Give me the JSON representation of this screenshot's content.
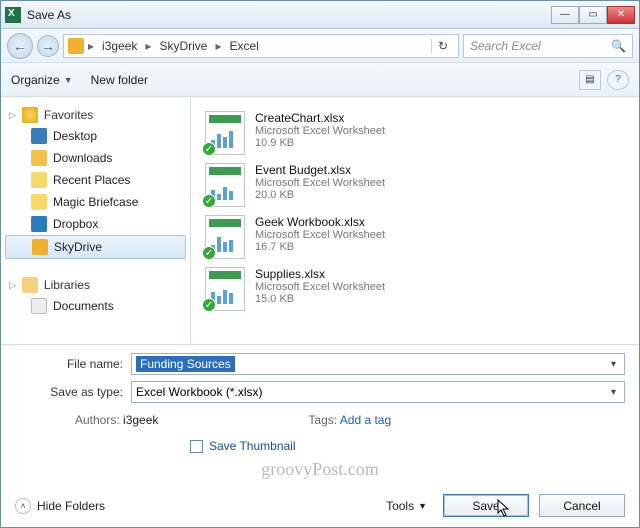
{
  "title": "Save As",
  "nav": {
    "back_glyph": "←",
    "fwd_glyph": "→"
  },
  "path": {
    "segments": [
      "i3geek",
      "SkyDrive",
      "Excel"
    ],
    "refresh_glyph": "↻"
  },
  "search": {
    "placeholder": "Search Excel",
    "icon_glyph": "🔍"
  },
  "toolbar": {
    "organize": "Organize",
    "newfolder": "New folder",
    "view_glyph": "▤",
    "help_glyph": "?"
  },
  "sidebar": {
    "favorites": {
      "label": "Favorites",
      "items": [
        {
          "label": "Desktop"
        },
        {
          "label": "Downloads"
        },
        {
          "label": "Recent Places"
        },
        {
          "label": "Magic Briefcase"
        },
        {
          "label": "Dropbox"
        },
        {
          "label": "SkyDrive"
        }
      ]
    },
    "libraries": {
      "label": "Libraries",
      "items": [
        {
          "label": "Documents"
        }
      ]
    }
  },
  "files": [
    {
      "name": "CreateChart.xlsx",
      "type": "Microsoft Excel Worksheet",
      "size": "10.9 KB"
    },
    {
      "name": "Event Budget.xlsx",
      "type": "Microsoft Excel Worksheet",
      "size": "20.0 KB"
    },
    {
      "name": "Geek Workbook.xlsx",
      "type": "Microsoft Excel Worksheet",
      "size": "16.7 KB"
    },
    {
      "name": "Supplies.xlsx",
      "type": "Microsoft Excel Worksheet",
      "size": "15.0 KB"
    }
  ],
  "form": {
    "filename_label": "File name:",
    "filename_value": "Funding Sources",
    "saveastype_label": "Save as type:",
    "saveastype_value": "Excel Workbook (*.xlsx)",
    "authors_label": "Authors:",
    "authors_value": "i3geek",
    "tags_label": "Tags:",
    "tags_value": "Add a tag",
    "save_thumbnail": "Save Thumbnail"
  },
  "footer": {
    "hide_folders": "Hide Folders",
    "tools": "Tools",
    "save": "Save",
    "cancel": "Cancel"
  },
  "watermark": "groovyPost.com",
  "winbtns": {
    "min": "—",
    "max": "▭",
    "close": "✕"
  }
}
